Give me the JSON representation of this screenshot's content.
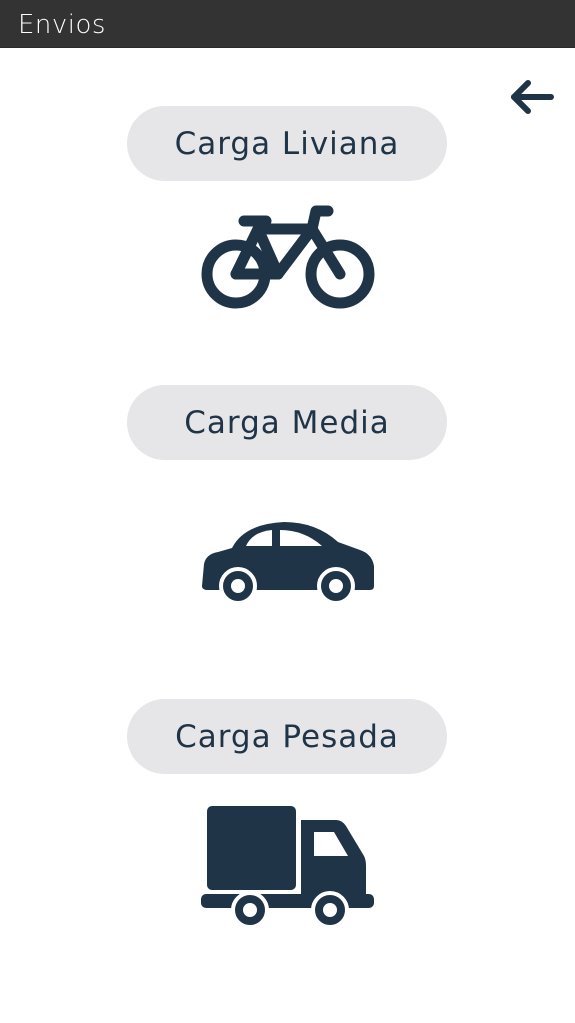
{
  "appbar": {
    "title": "Envios",
    "background": "#333333"
  },
  "back_button": {
    "icon": "arrow-left-icon"
  },
  "options": [
    {
      "label": "Carga Liviana",
      "icon": "bicycle-icon"
    },
    {
      "label": "Carga Media",
      "icon": "car-icon"
    },
    {
      "label": "Carga Pesada",
      "icon": "truck-icon"
    }
  ],
  "colors": {
    "accent": "#1f3447",
    "pill_background": "#e6e6e8"
  }
}
